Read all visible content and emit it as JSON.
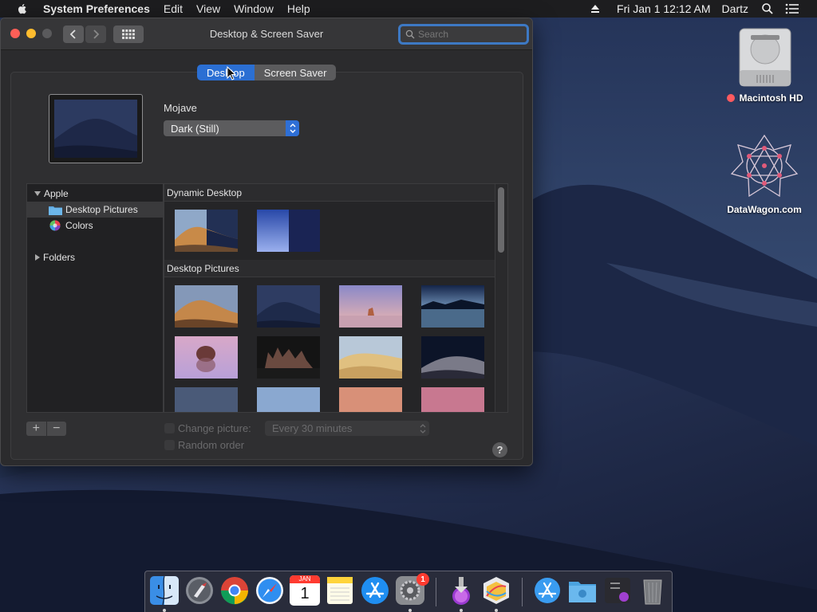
{
  "menubar": {
    "app_name": "System Preferences",
    "menus": [
      "Edit",
      "View",
      "Window",
      "Help"
    ],
    "clock": "Fri Jan 1  12:12 AM",
    "user": "Dartz"
  },
  "desktop_icons": [
    {
      "label": "Macintosh HD",
      "icon": "hard-drive-icon"
    },
    {
      "label": "DataWagon.com",
      "icon": "datawagon-logo-icon"
    }
  ],
  "window": {
    "title": "Desktop & Screen Saver",
    "search_placeholder": "Search",
    "tabs": [
      {
        "label": "Desktop",
        "selected": true
      },
      {
        "label": "Screen Saver",
        "selected": false
      }
    ],
    "wallpaper_name": "Mojave",
    "wallpaper_mode": "Dark (Still)",
    "sidebar": {
      "apple_group": "Apple",
      "items": [
        {
          "label": "Desktop Pictures",
          "icon": "folder-icon",
          "selected": true
        },
        {
          "label": "Colors",
          "icon": "color-wheel-icon",
          "selected": false
        }
      ],
      "folders_group": "Folders"
    },
    "sections": [
      {
        "title": "Dynamic Desktop"
      },
      {
        "title": "Desktop Pictures"
      }
    ],
    "change_picture_label": "Change picture:",
    "change_interval": "Every 30 minutes",
    "random_order_label": "Random order",
    "help_label": "?"
  },
  "dock": {
    "apps": [
      "Finder",
      "Launchpad",
      "Chrome",
      "Safari",
      "Calendar",
      "Notes",
      "App Store",
      "System Preferences",
      "Downloader",
      "Grapher",
      "App Store Folder",
      "Documents",
      "Utility",
      "Trash"
    ],
    "calendar_month": "JAN",
    "calendar_day": "1",
    "badge_count": "1"
  },
  "colors": {
    "accent": "#2b6fd3",
    "window_bg": "#2b2b2d"
  }
}
